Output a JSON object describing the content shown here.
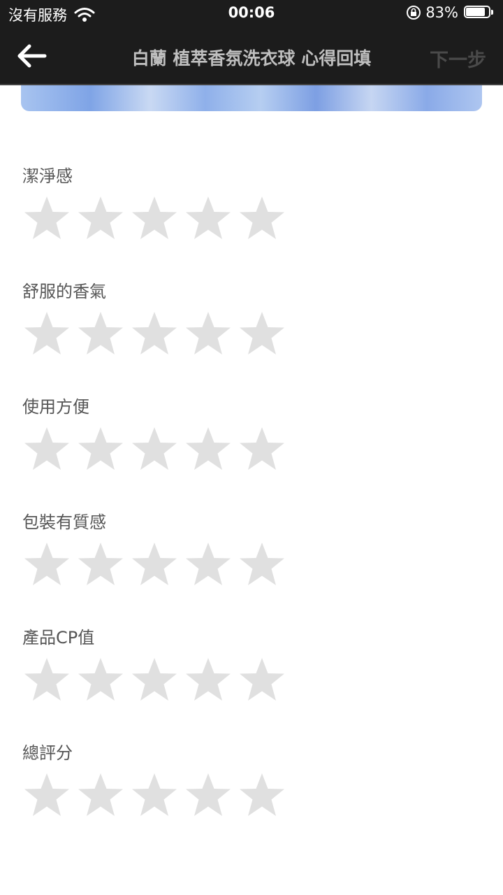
{
  "status_bar": {
    "carrier": "沒有服務",
    "time": "00:06",
    "battery_percent": "83%",
    "battery_level": 0.83
  },
  "nav": {
    "title": "白蘭 植萃香氛洗衣球 心得回填",
    "next_label": "下一步"
  },
  "ratings": [
    {
      "label": "潔淨感",
      "value": 0,
      "max": 5
    },
    {
      "label": "舒服的香氣",
      "value": 0,
      "max": 5
    },
    {
      "label": "使用方便",
      "value": 0,
      "max": 5
    },
    {
      "label": "包裝有質感",
      "value": 0,
      "max": 5
    },
    {
      "label": "產品CP值",
      "value": 0,
      "max": 5
    },
    {
      "label": "總評分",
      "value": 0,
      "max": 5
    }
  ],
  "colors": {
    "header_bg": "#1c1c1c",
    "star_empty": "#e0e0e0",
    "label_text": "#555555"
  }
}
